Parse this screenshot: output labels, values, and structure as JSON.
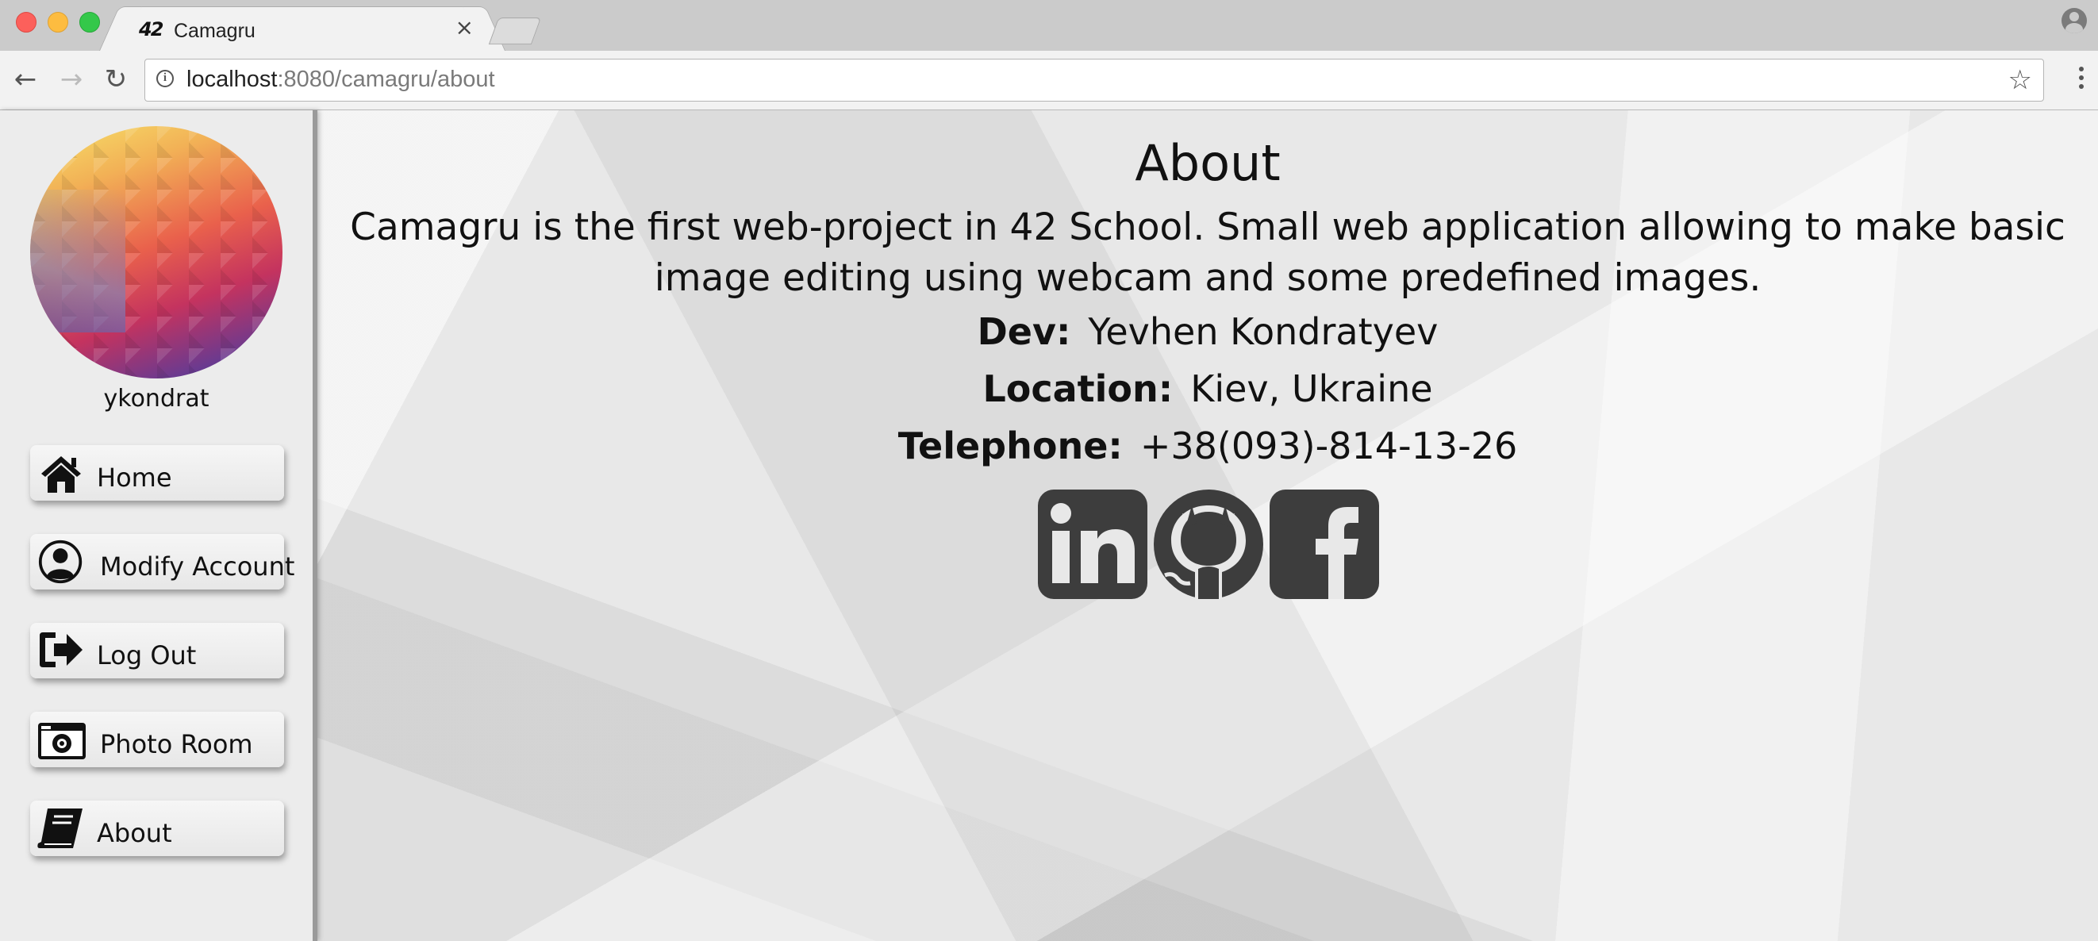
{
  "browser": {
    "tab_title": "Camagru",
    "tab_favicon": "42",
    "tab_close": "×",
    "url_host": "localhost",
    "url_rest": ":8080/camagru/about",
    "icons": [
      "back-arrow-icon",
      "forward-arrow-icon",
      "reload-icon",
      "info-icon",
      "star-icon",
      "menu-icon",
      "profile-icon"
    ]
  },
  "sidebar": {
    "username": "ykondrat",
    "items": [
      {
        "label": "Home",
        "icon": "home-icon"
      },
      {
        "label": "Modify Account",
        "icon": "user-icon"
      },
      {
        "label": "Log Out",
        "icon": "logout-icon"
      },
      {
        "label": "Photo Room",
        "icon": "camera-icon"
      },
      {
        "label": "About",
        "icon": "book-icon"
      }
    ]
  },
  "main": {
    "title": "About",
    "description": "Camagru is the first web-project in 42 School. Small web application allowing to make basic image editing using webcam and some predefined images.",
    "dev_label": "Dev:",
    "dev_value": "Yevhen Kondratyev",
    "location_label": "Location:",
    "location_value": "Kiev, Ukraine",
    "telephone_label": "Telephone:",
    "telephone_value": "+38(093)-814-13-26",
    "socials": [
      "linkedin-icon",
      "github-icon",
      "facebook-icon"
    ]
  },
  "colors": {
    "icon_dark": "#3d3d3d",
    "page_bg": "#e8e8e8",
    "sidebar_bg": "#ececec",
    "tab_active_bg": "#f2f2f2"
  }
}
